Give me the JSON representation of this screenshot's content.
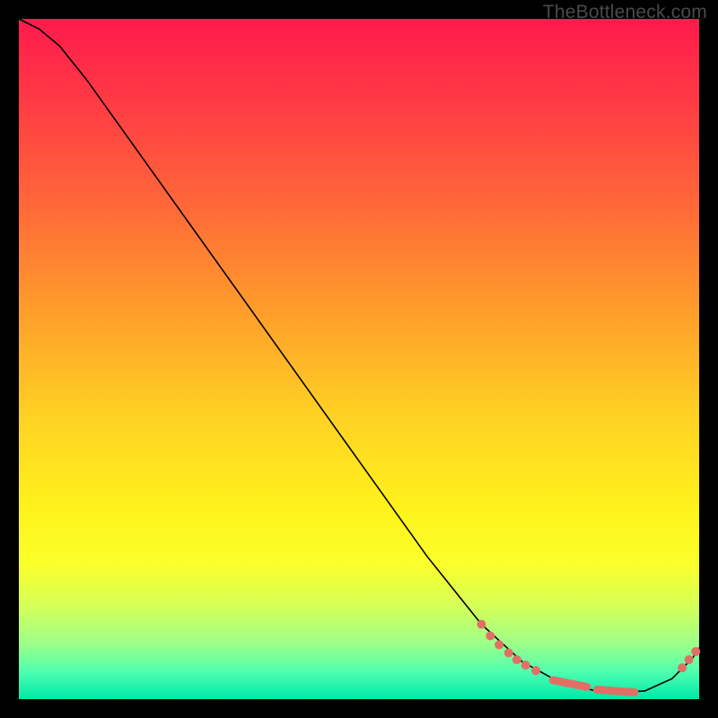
{
  "watermark": "TheBottleneck.com",
  "chart_data": {
    "type": "line",
    "title": "",
    "xlabel": "",
    "ylabel": "",
    "xlim": [
      0,
      100
    ],
    "ylim": [
      0,
      100
    ],
    "curve": [
      {
        "x": 0.0,
        "y": 100.0
      },
      {
        "x": 3.0,
        "y": 98.5
      },
      {
        "x": 6.0,
        "y": 96.0
      },
      {
        "x": 10.0,
        "y": 91.0
      },
      {
        "x": 20.0,
        "y": 77.0
      },
      {
        "x": 30.0,
        "y": 63.0
      },
      {
        "x": 40.0,
        "y": 49.0
      },
      {
        "x": 50.0,
        "y": 35.0
      },
      {
        "x": 60.0,
        "y": 21.0
      },
      {
        "x": 68.0,
        "y": 11.0
      },
      {
        "x": 74.0,
        "y": 5.5
      },
      {
        "x": 80.0,
        "y": 2.2
      },
      {
        "x": 86.0,
        "y": 1.0
      },
      {
        "x": 92.0,
        "y": 1.2
      },
      {
        "x": 96.0,
        "y": 3.0
      },
      {
        "x": 99.0,
        "y": 6.0
      },
      {
        "x": 100.0,
        "y": 7.5
      }
    ],
    "sparse_points": [
      {
        "x": 68.0,
        "y": 11.0
      },
      {
        "x": 69.3,
        "y": 9.3
      },
      {
        "x": 70.6,
        "y": 8.0
      },
      {
        "x": 72.0,
        "y": 6.8
      },
      {
        "x": 73.2,
        "y": 5.8
      },
      {
        "x": 74.5,
        "y": 5.0
      },
      {
        "x": 76.0,
        "y": 4.2
      },
      {
        "x": 97.5,
        "y": 4.6
      },
      {
        "x": 98.5,
        "y": 5.8
      },
      {
        "x": 99.5,
        "y": 7.0
      }
    ],
    "dense_clusters": [
      {
        "x_start": 78.5,
        "x_end": 83.5,
        "count": 20,
        "y_from": 2.8,
        "y_to": 1.8
      },
      {
        "x_start": 85.0,
        "x_end": 90.5,
        "count": 22,
        "y_from": 1.4,
        "y_to": 1.0
      }
    ],
    "point_color": "#e07066",
    "line_color": "#000000"
  }
}
